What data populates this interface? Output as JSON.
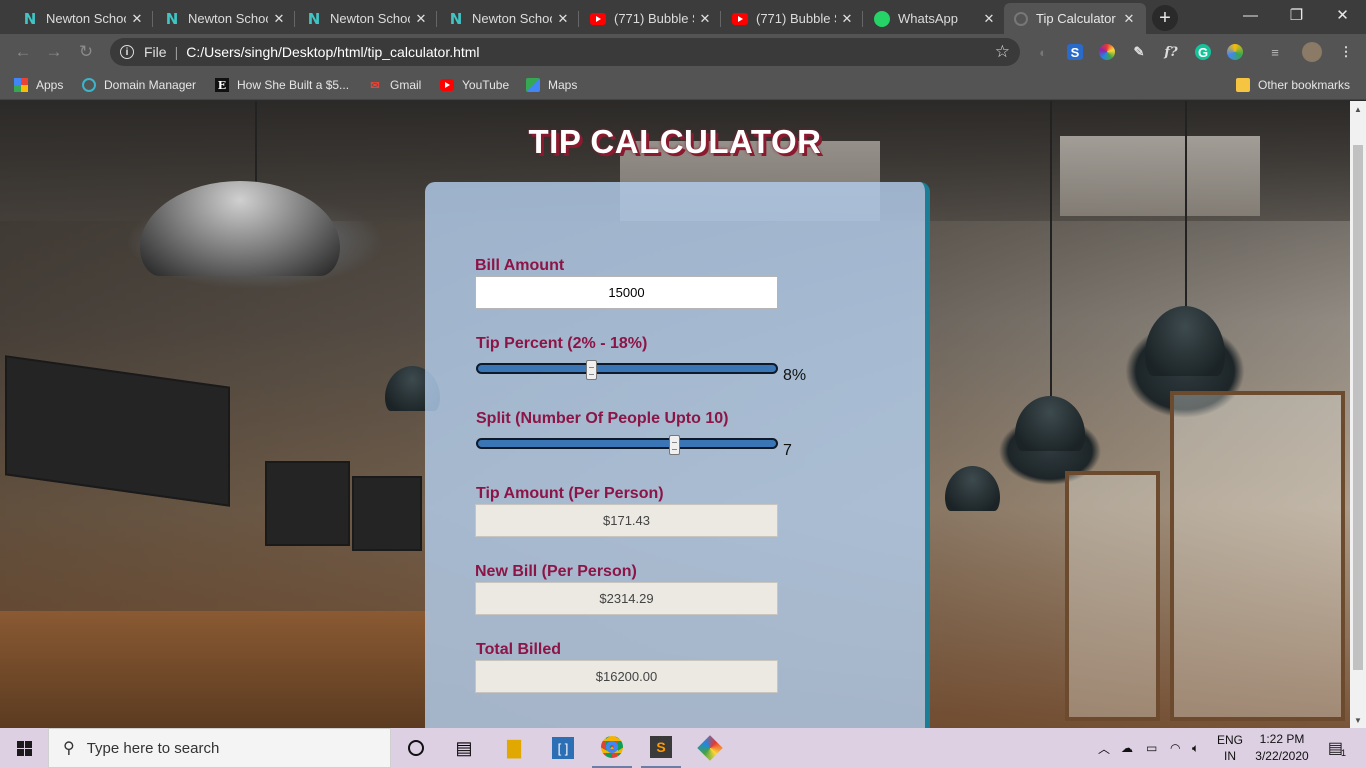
{
  "browser": {
    "tabs": [
      {
        "title": "Newton Schoo",
        "icon": "newton-favicon",
        "active": false
      },
      {
        "title": "Newton Schoo",
        "icon": "newton-favicon",
        "active": false
      },
      {
        "title": "Newton Schoo",
        "icon": "newton-favicon",
        "active": false
      },
      {
        "title": "Newton Schoo",
        "icon": "newton-favicon",
        "active": false
      },
      {
        "title": "(771) Bubble S",
        "icon": "youtube-favicon",
        "active": false
      },
      {
        "title": "(771) Bubble S",
        "icon": "youtube-favicon",
        "active": false
      },
      {
        "title": "WhatsApp",
        "icon": "whatsapp-favicon",
        "active": false
      },
      {
        "title": "Tip Calculator",
        "icon": "globe-favicon",
        "active": true
      }
    ],
    "address": {
      "scheme_label": "File",
      "url": "C:/Users/singh/Desktop/html/tip_calculator.html"
    },
    "bookmarks": [
      {
        "label": "Apps",
        "icon": "apps-grid-icon"
      },
      {
        "label": "Domain Manager",
        "icon": "domain-manager-icon"
      },
      {
        "label": "How She Built a $5...",
        "icon": "e-letter-icon"
      },
      {
        "label": "Gmail",
        "icon": "gmail-icon"
      },
      {
        "label": "YouTube",
        "icon": "youtube-icon"
      },
      {
        "label": "Maps",
        "icon": "maps-icon"
      }
    ],
    "other_bookmarks": "Other bookmarks"
  },
  "page": {
    "title": "TIP CALCULATOR",
    "bill": {
      "label": "Bill Amount",
      "value": "15000"
    },
    "tip": {
      "label": "Tip Percent (2% - 18%)",
      "value_text": "8%",
      "value": 8,
      "min": 2,
      "max": 18
    },
    "split": {
      "label": "Split (Number Of People Upto 10)",
      "value_text": "7",
      "value": 7,
      "min": 1,
      "max": 10
    },
    "tip_amount": {
      "label": "Tip Amount (Per Person)",
      "value": "$171.43"
    },
    "new_bill": {
      "label": "New Bill (Per Person)",
      "value": "$2314.29"
    },
    "total": {
      "label": "Total Billed",
      "value": "$16200.00"
    }
  },
  "taskbar": {
    "search_placeholder": "Type here to search",
    "lang_1": "ENG",
    "lang_2": "IN",
    "time": "1:22 PM",
    "date": "3/22/2020",
    "notifications": "1"
  },
  "colors": {
    "label": "#8c1446",
    "title_shadow": "#8b1a2f",
    "slider": "#3a76b5",
    "card_border": "#1b7d96"
  }
}
